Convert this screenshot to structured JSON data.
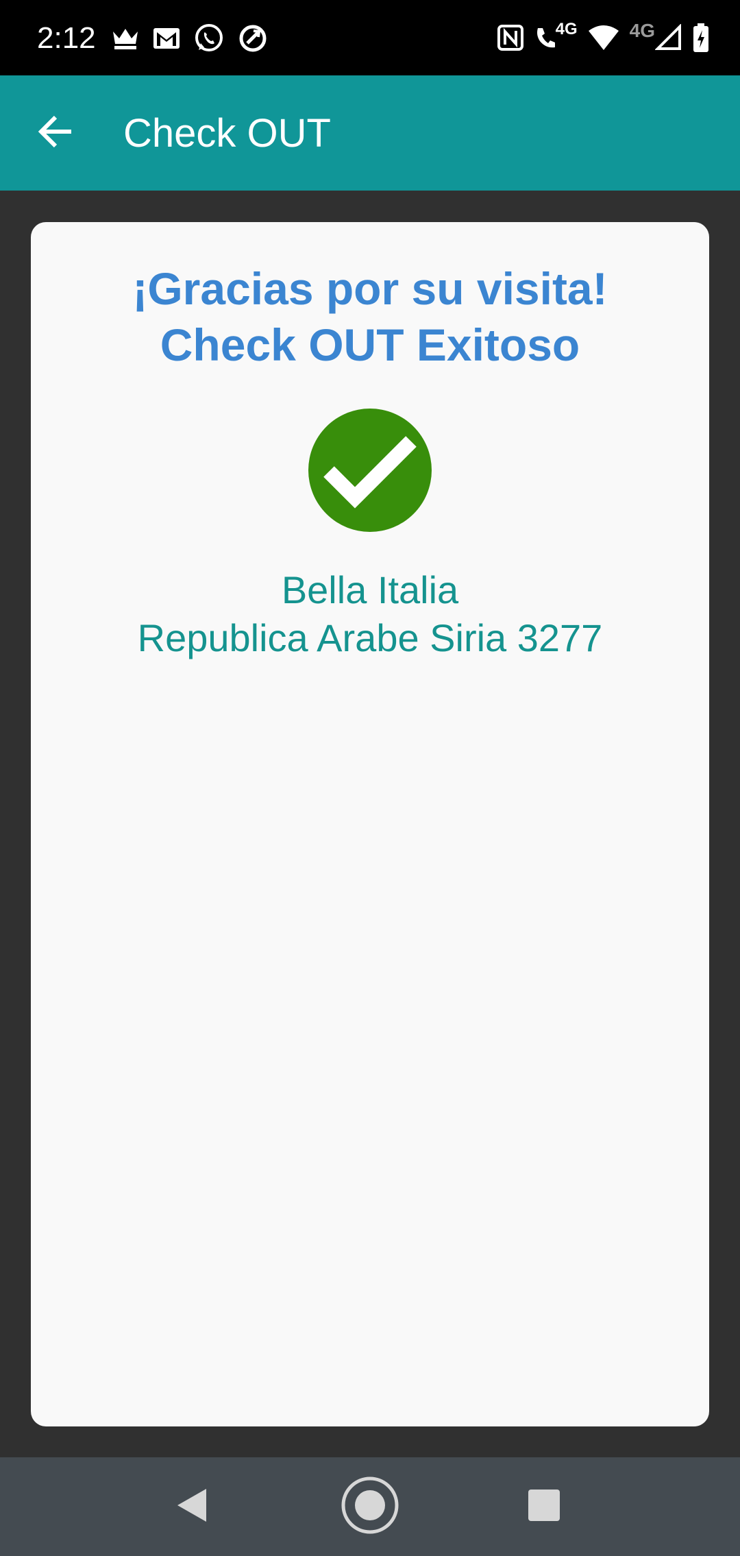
{
  "status_bar": {
    "time": "2:12",
    "left_icons": [
      "crown-icon",
      "gmail-icon",
      "whatsapp-icon",
      "sync-icon"
    ],
    "right_icons": [
      "nfc-icon",
      "volte-call-icon",
      "wifi-icon",
      "signal-icon",
      "battery-charging-icon"
    ],
    "volte_label": "4G",
    "network_label": "4G"
  },
  "app_bar": {
    "title": "Check OUT",
    "background_color": "#109698"
  },
  "card": {
    "headline_line1": "¡Gracias por su visita!",
    "headline_line2": "Check OUT Exitoso",
    "headline_color": "#3b85d1",
    "success_icon": "check-circle-icon",
    "success_color": "#388e0b",
    "place_name": "Bella Italia",
    "place_address": "Republica Arabe Siria 3277",
    "place_color": "#15938f"
  },
  "nav_bar": {
    "buttons": [
      "back-triangle-icon",
      "home-circle-icon",
      "recents-square-icon"
    ]
  }
}
